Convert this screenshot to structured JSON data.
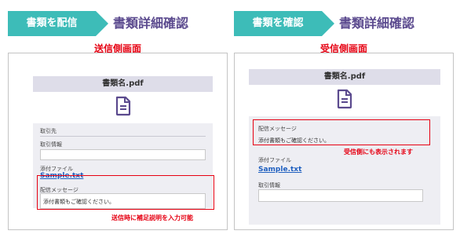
{
  "left": {
    "step_label": "書類を配信",
    "step_title": "書類詳細確認",
    "side_label": "送信側画面",
    "doc_title": "書類名.pdf",
    "fields": {
      "partner_label": "取引先",
      "info_label": "取引情報",
      "attachment_label": "添付ファイル",
      "attachment_file": "Sample.txt",
      "message_label": "配信メッセージ",
      "message_text": "添付書類もご確認ください。"
    },
    "note": "送信時に補足説明を入力可能"
  },
  "right": {
    "step_label": "書類を確認",
    "step_title": "書類詳細確認",
    "side_label": "受信側画面",
    "doc_title": "書類名.pdf",
    "fields": {
      "message_label": "配信メッセージ",
      "message_text": "添付書類もご確認ください。",
      "attachment_label": "添付ファイル",
      "attachment_file": "Sample.txt",
      "info_label": "取引情報"
    },
    "note": "受信側にも表示されます"
  },
  "colors": {
    "chevron": "#3dbcb8",
    "title": "#5b4a8e",
    "accent_red": "#e60012",
    "icon": "#5b4a8e"
  }
}
